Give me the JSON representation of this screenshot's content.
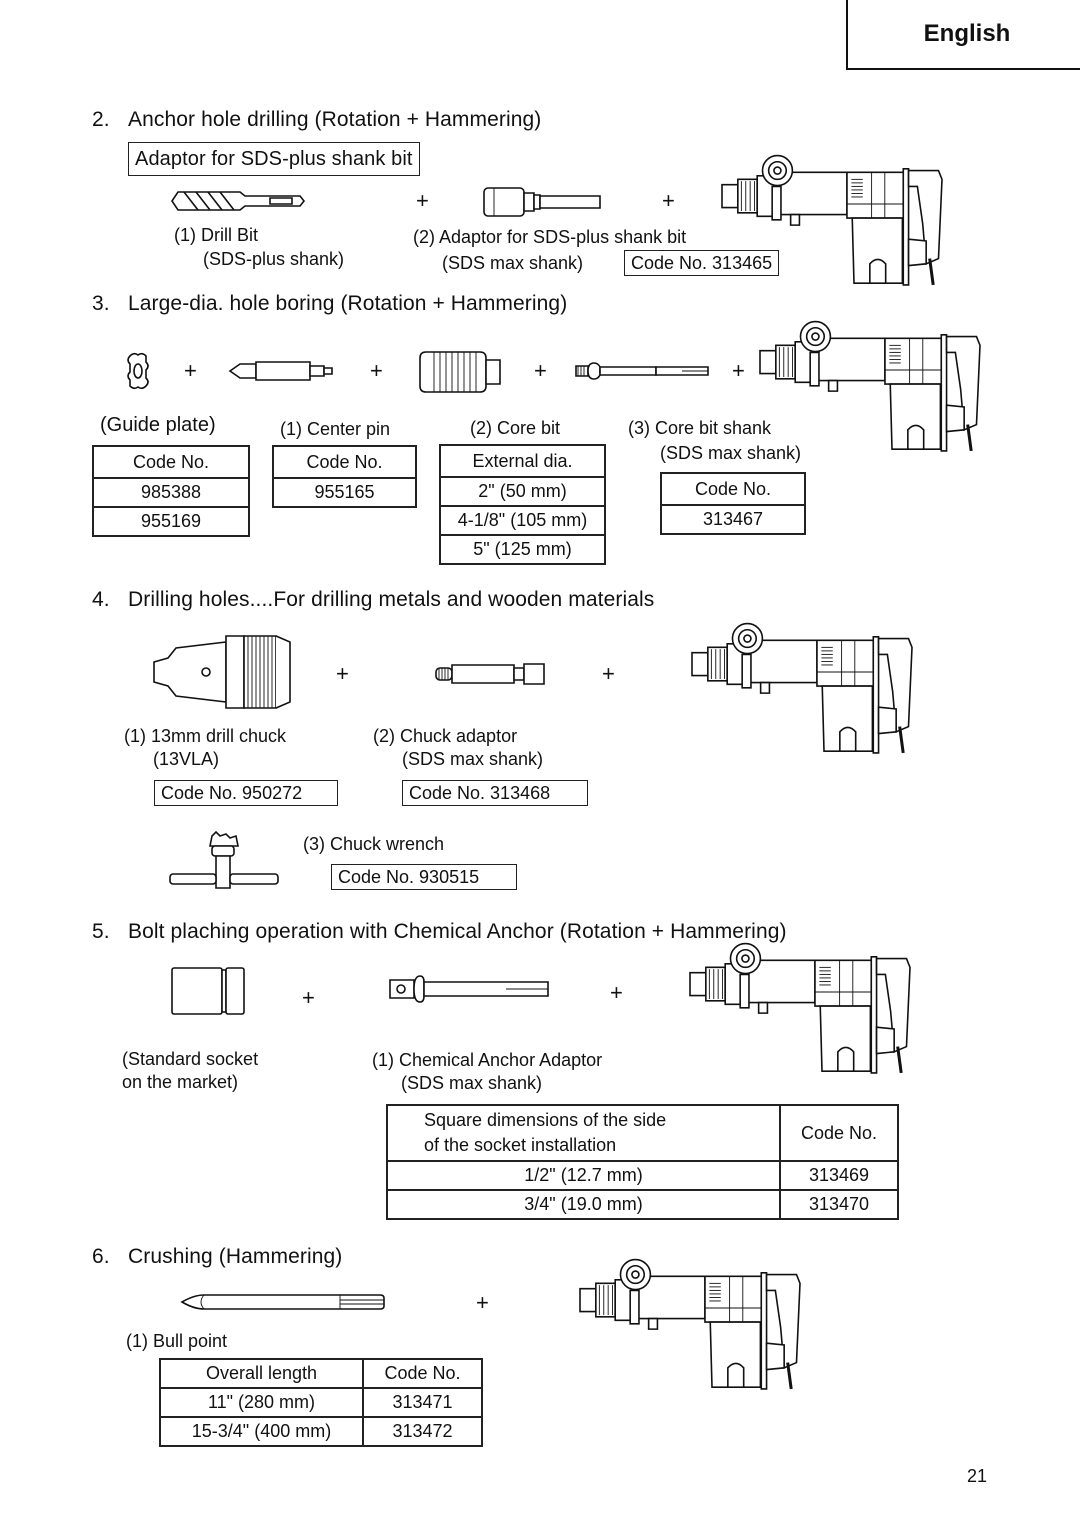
{
  "header": {
    "language_tab": "English"
  },
  "sections": [
    {
      "number": "2.",
      "title": "Anchor hole drilling (Rotation + Hammering)",
      "subtitle_box": "Adaptor for SDS-plus shank bit",
      "items": [
        {
          "label": "(1) Drill Bit",
          "sublabel": "(SDS-plus shank)"
        },
        {
          "label": "(2) Adaptor for SDS-plus shank bit",
          "sublabel": "(SDS max shank)",
          "code": "Code No. 313465"
        }
      ],
      "plus": "+"
    },
    {
      "number": "3.",
      "title": "Large-dia. hole boring (Rotation + Hammering)",
      "plus": "+",
      "guide_plate": {
        "label": "(Guide plate)",
        "table": {
          "header": "Code No.",
          "rows": [
            "985388",
            "955169"
          ]
        }
      },
      "center_pin": {
        "label": "(1) Center pin",
        "table": {
          "header": "Code No.",
          "rows": [
            "955165"
          ]
        }
      },
      "core_bit": {
        "label": "(2) Core bit",
        "table": {
          "header": "External dia.",
          "rows": [
            "2\" (50 mm)",
            "4-1/8\" (105 mm)",
            "5\" (125 mm)"
          ]
        }
      },
      "core_bit_shank": {
        "label": "(3) Core bit shank",
        "sublabel": "(SDS max shank)",
        "table": {
          "header": "Code No.",
          "rows": [
            "313467"
          ]
        }
      }
    },
    {
      "number": "4.",
      "title": "Drilling holes....For drilling metals and wooden materials",
      "plus": "+",
      "items": [
        {
          "label": "(1) 13mm drill chuck",
          "sublabel": "(13VLA)",
          "code": "Code No. 950272"
        },
        {
          "label": "(2) Chuck adaptor",
          "sublabel": "(SDS max shank)",
          "code": "Code No. 313468"
        },
        {
          "label": "(3) Chuck wrench",
          "code": "Code No. 930515"
        }
      ]
    },
    {
      "number": "5.",
      "title": "Bolt plaching operation with Chemical Anchor (Rotation + Hammering)",
      "plus": "+",
      "socket_label": "(Standard socket",
      "socket_label_2": "on the market)",
      "adaptor_label": "(1) Chemical Anchor Adaptor",
      "adaptor_sublabel": "(SDS max shank)",
      "table": {
        "header_1_line1": "Square dimensions of the side",
        "header_1_line2": "of the socket installation",
        "header_2": "Code No.",
        "rows": [
          {
            "size": "1/2\" (12.7 mm)",
            "code": "313469"
          },
          {
            "size": "3/4\" (19.0 mm)",
            "code": "313470"
          }
        ]
      }
    },
    {
      "number": "6.",
      "title": "Crushing (Hammering)",
      "plus": "+",
      "item_label": "(1) Bull point",
      "table": {
        "header_1": "Overall length",
        "header_2": "Code No.",
        "rows": [
          {
            "length": "11\" (280 mm)",
            "code": "313471"
          },
          {
            "length": "15-3/4\" (400 mm)",
            "code": "313472"
          }
        ]
      }
    }
  ],
  "footer": {
    "page_number": "21"
  }
}
